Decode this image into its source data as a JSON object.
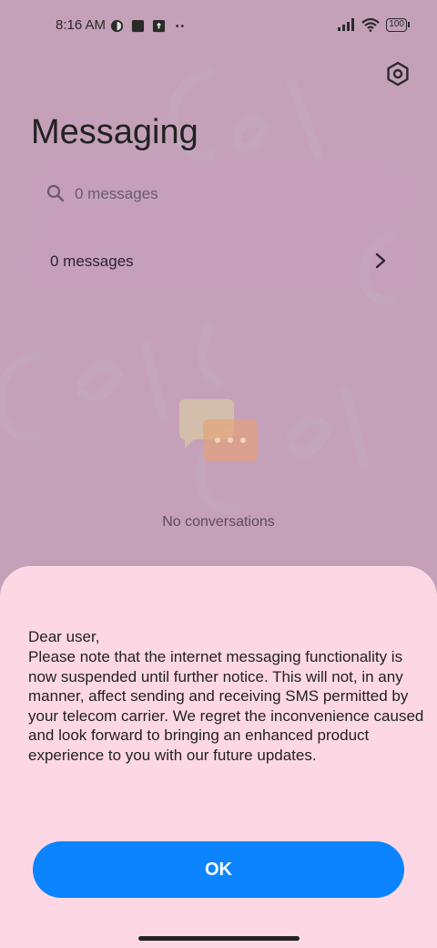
{
  "status_bar": {
    "time": "8:16 AM",
    "battery": "100",
    "left_icons": [
      "app-notification-icon",
      "square-notification-icon",
      "upload-notification-icon",
      "more-dots-icon"
    ],
    "right_icons": [
      "signal-icon",
      "wifi-icon",
      "battery-icon"
    ]
  },
  "header": {
    "title": "Messaging",
    "settings_icon": "settings-icon"
  },
  "search": {
    "placeholder": "0 messages"
  },
  "messages_card": {
    "label": "0 messages"
  },
  "empty_state": {
    "text": "No conversations"
  },
  "dialog": {
    "greeting": "Dear user,",
    "body": "Please note that the internet messaging functionality is now suspended until further notice. This will not, in any manner, affect sending and receiving SMS permitted by your telecom carrier. We regret the inconvenience caused and look forward to bringing an enhanced product experience to you with our future updates.",
    "ok_label": "OK"
  },
  "colors": {
    "accent": "#0d84ff",
    "sheet_background": "#fdd8e4",
    "scrim": "#a37aa0"
  }
}
